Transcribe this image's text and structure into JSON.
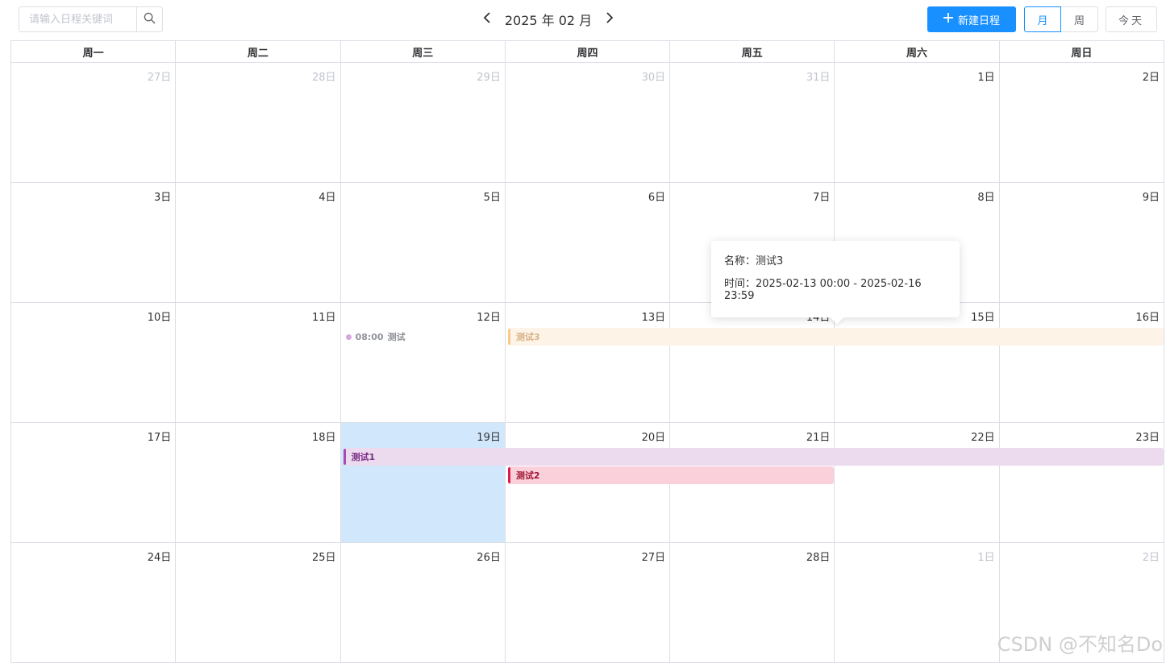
{
  "toolbar": {
    "search_placeholder": "请输入日程关键词",
    "month_title": "2025 年 02 月",
    "new_button": "新建日程",
    "view_month": "月",
    "view_week": "周",
    "today_button": "今天"
  },
  "weekdays": [
    "周一",
    "周二",
    "周三",
    "周四",
    "周五",
    "周六",
    "周日"
  ],
  "weeks": [
    [
      {
        "label": "27日",
        "other": true
      },
      {
        "label": "28日",
        "other": true
      },
      {
        "label": "29日",
        "other": true
      },
      {
        "label": "30日",
        "other": true
      },
      {
        "label": "31日",
        "other": true
      },
      {
        "label": "1日",
        "other": false
      },
      {
        "label": "2日",
        "other": false
      }
    ],
    [
      {
        "label": "3日",
        "other": false
      },
      {
        "label": "4日",
        "other": false
      },
      {
        "label": "5日",
        "other": false
      },
      {
        "label": "6日",
        "other": false
      },
      {
        "label": "7日",
        "other": false
      },
      {
        "label": "8日",
        "other": false
      },
      {
        "label": "9日",
        "other": false
      }
    ],
    [
      {
        "label": "10日",
        "other": false
      },
      {
        "label": "11日",
        "other": false
      },
      {
        "label": "12日",
        "other": false
      },
      {
        "label": "13日",
        "other": false
      },
      {
        "label": "14日",
        "other": false
      },
      {
        "label": "15日",
        "other": false
      },
      {
        "label": "16日",
        "other": false
      }
    ],
    [
      {
        "label": "17日",
        "other": false
      },
      {
        "label": "18日",
        "other": false
      },
      {
        "label": "19日",
        "other": false,
        "today": true
      },
      {
        "label": "20日",
        "other": false
      },
      {
        "label": "21日",
        "other": false
      },
      {
        "label": "22日",
        "other": false
      },
      {
        "label": "23日",
        "other": false
      }
    ],
    [
      {
        "label": "24日",
        "other": false
      },
      {
        "label": "25日",
        "other": false
      },
      {
        "label": "26日",
        "other": false
      },
      {
        "label": "27日",
        "other": false
      },
      {
        "label": "28日",
        "other": false
      },
      {
        "label": "1日",
        "other": true
      },
      {
        "label": "2日",
        "other": true
      }
    ]
  ],
  "events": [
    {
      "title": "测试3",
      "start": "2025-02-13",
      "end": "2025-02-16",
      "bg": "#fdf3e7",
      "stripe": "#f7c98a",
      "text": "#d9b486"
    },
    {
      "title": "测试1",
      "start": "2025-02-19",
      "end": "2025-02-23",
      "bg": "#ecdaee",
      "stripe": "#a44cb3",
      "text": "#7b2d86"
    },
    {
      "title": "测试2",
      "start": "2025-02-20",
      "end": "2025-02-21",
      "bg": "#fad1db",
      "stripe": "#d81b48",
      "text": "#a11635"
    }
  ],
  "timed_events": [
    {
      "time": "08:00",
      "title": "测试",
      "date": "2025-02-12",
      "dot": "#d4a7dc"
    }
  ],
  "tooltip": {
    "name_line": "名称：测试3",
    "time_line": "时间：2025-02-13 00:00 - 2025-02-16 23:59"
  },
  "watermark": "CSDN @不知名Do",
  "colors": {
    "accent": "#1890ff",
    "today_bg": "#d1e8fc",
    "border": "#dcdfe6"
  }
}
